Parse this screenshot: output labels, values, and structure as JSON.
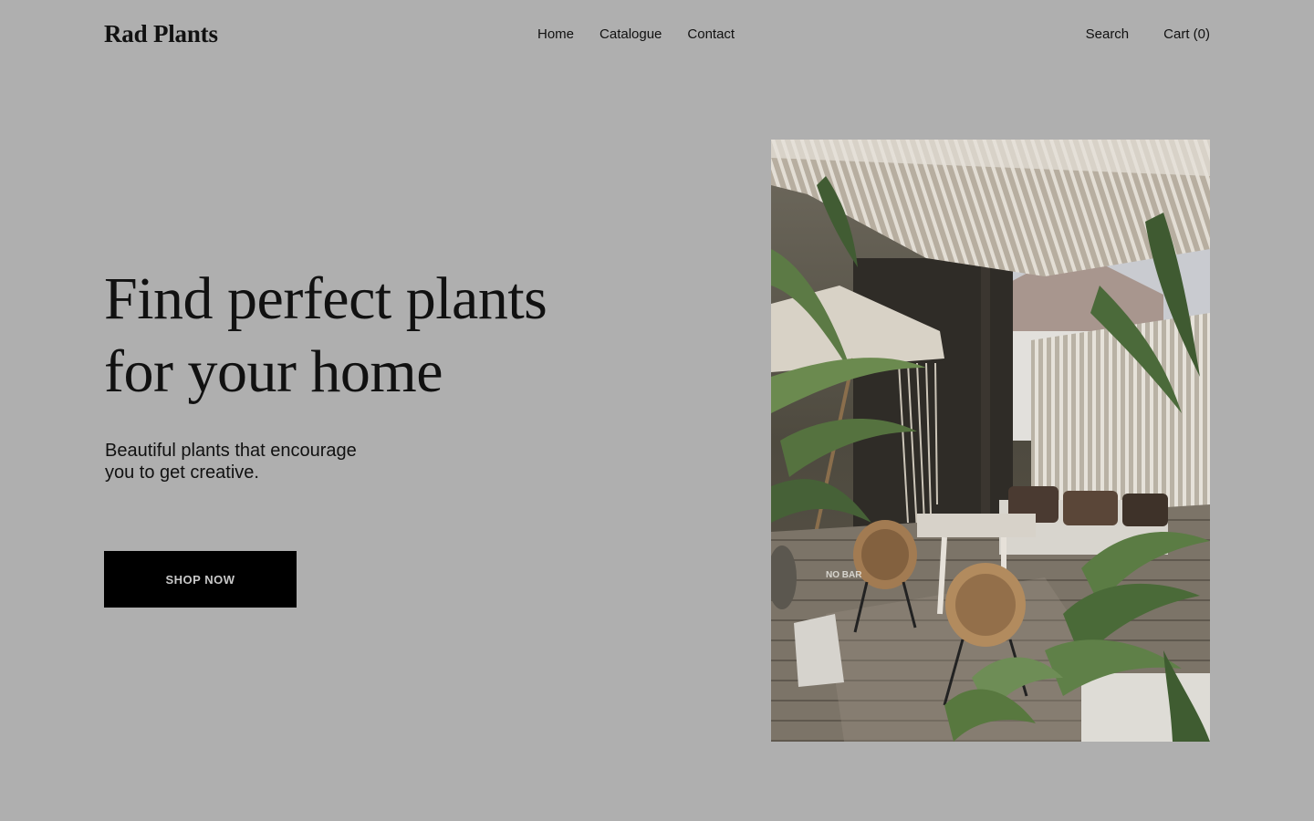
{
  "brand": {
    "name": "Rad Plants"
  },
  "nav": {
    "items": [
      {
        "label": "Home"
      },
      {
        "label": "Catalogue"
      },
      {
        "label": "Contact"
      }
    ]
  },
  "utility": {
    "search_label": "Search",
    "cart_label": "Cart (0)"
  },
  "hero": {
    "title_line1": "Find perfect plants",
    "title_line2": "for your home",
    "subtitle": "Beautiful plants that encourage you to get creative.",
    "cta_label": "SHOP NOW",
    "image_sign_text": "NO BAR"
  },
  "colors": {
    "background": "#afafaf",
    "text": "#111111",
    "button_bg": "#000000",
    "button_text": "#c8c8c8"
  }
}
